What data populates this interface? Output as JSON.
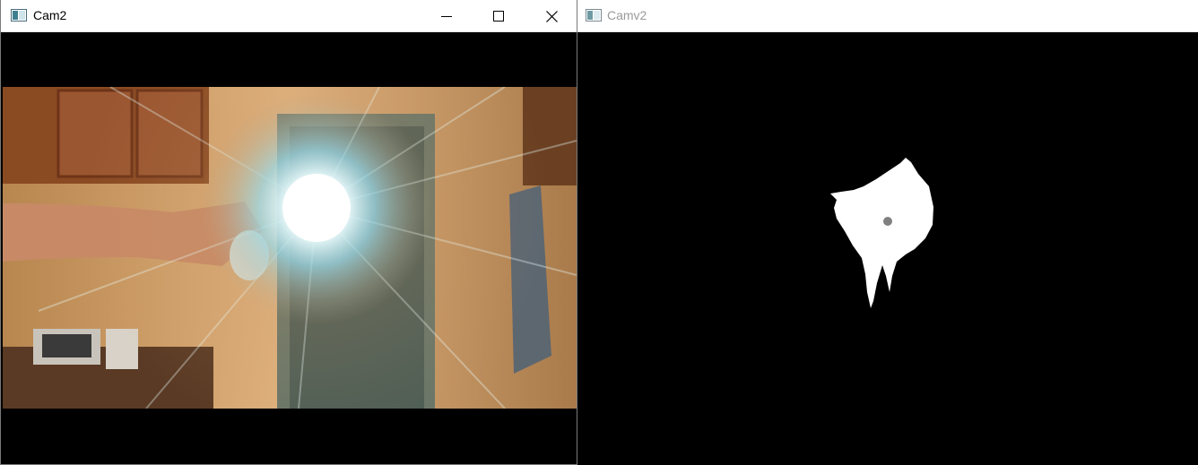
{
  "windows": {
    "cam2": {
      "title": "Cam2",
      "icon": "opencv-window-icon",
      "controls": [
        "minimize-icon",
        "maximize-icon",
        "close-icon"
      ]
    },
    "camv2": {
      "title": "Camv2",
      "icon": "opencv-window-icon"
    }
  },
  "colors": {
    "titlebar_bg": "#ffffff",
    "inactive_title": "#9a9a9a",
    "canvas_bg": "#000000",
    "mask_blob": "#ffffff",
    "centroid_dot": "#808080"
  }
}
